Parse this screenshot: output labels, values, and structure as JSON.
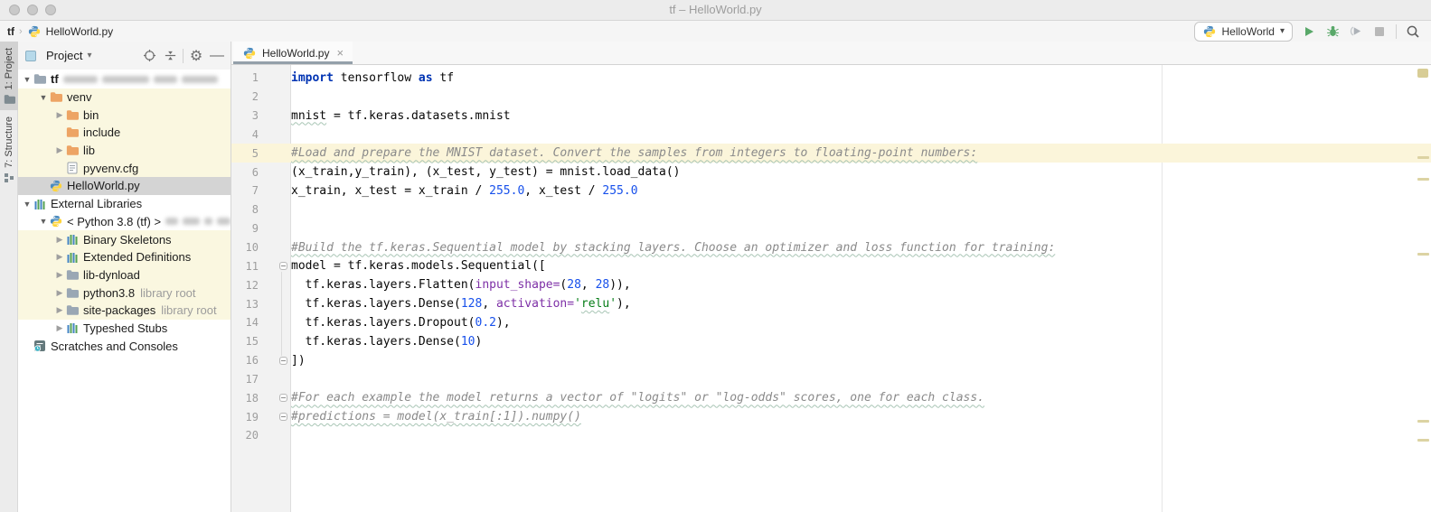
{
  "window": {
    "title": "tf – HelloWorld.py",
    "traffic_lights": [
      "close",
      "minimize",
      "zoom"
    ]
  },
  "breadcrumb": {
    "root": "tf",
    "separator": "›",
    "file": "HelloWorld.py",
    "file_icon": "python-icon"
  },
  "toolbar": {
    "run_config": {
      "label": "HelloWorld",
      "icon": "python-icon",
      "caret": "▾"
    },
    "actions": [
      {
        "name": "run-button",
        "icon": "play-icon",
        "color": "#59a869"
      },
      {
        "name": "debug-button",
        "icon": "bug-icon",
        "color": "#59a869"
      },
      {
        "name": "coverage-button",
        "icon": "run-with-coverage-icon",
        "color": "#9aa0a6"
      },
      {
        "name": "stop-button",
        "icon": "stop-icon",
        "color": "#b8b8b8"
      },
      {
        "name": "search-everywhere-button",
        "icon": "search-icon",
        "color": "#5f5f5f"
      }
    ]
  },
  "tool_strip": {
    "items": [
      {
        "label": "1: Project",
        "icon": "project-tool-icon",
        "active": true
      },
      {
        "label": "7: Structure",
        "icon": "structure-tool-icon",
        "active": false
      }
    ]
  },
  "project_panel": {
    "title": "Project",
    "caret": "▾",
    "header_icons": [
      "locate-icon",
      "collapse-all-icon",
      "settings-gear-icon",
      "hide-icon"
    ],
    "tree": [
      {
        "level": 0,
        "arrow": "exp",
        "icon": "folder",
        "label": "tf",
        "bold": true,
        "redacted": true,
        "bg": "none"
      },
      {
        "level": 1,
        "arrow": "exp",
        "icon": "folder-orange",
        "label": "venv",
        "bg": "yellow"
      },
      {
        "level": 2,
        "arrow": "col",
        "icon": "folder-orange",
        "label": "bin",
        "bg": "yellow"
      },
      {
        "level": 2,
        "arrow": "none",
        "icon": "folder-orange",
        "label": "include",
        "bg": "yellow"
      },
      {
        "level": 2,
        "arrow": "col",
        "icon": "folder-orange",
        "label": "lib",
        "bg": "yellow"
      },
      {
        "level": 2,
        "arrow": "none",
        "icon": "file",
        "label": "pyvenv.cfg",
        "bg": "yellow"
      },
      {
        "level": 1,
        "arrow": "none",
        "icon": "python",
        "label": "HelloWorld.py",
        "bg": "selected"
      },
      {
        "level": 0,
        "arrow": "exp",
        "icon": "library",
        "label": "External Libraries",
        "bg": "none"
      },
      {
        "level": 1,
        "arrow": "exp",
        "icon": "python",
        "label": "< Python 3.8 (tf) >",
        "redacted": true,
        "bg": "none"
      },
      {
        "level": 2,
        "arrow": "col",
        "icon": "library",
        "label": "Binary Skeletons",
        "bg": "yellow"
      },
      {
        "level": 2,
        "arrow": "col",
        "icon": "library",
        "label": "Extended Definitions",
        "bg": "yellow"
      },
      {
        "level": 2,
        "arrow": "col",
        "icon": "folder",
        "label": "lib-dynload",
        "bg": "yellow"
      },
      {
        "level": 2,
        "arrow": "col",
        "icon": "folder",
        "label": "python3.8",
        "suffix": "library root",
        "bg": "yellow"
      },
      {
        "level": 2,
        "arrow": "col",
        "icon": "folder",
        "label": "site-packages",
        "suffix": "library root",
        "bg": "yellow"
      },
      {
        "level": 2,
        "arrow": "col",
        "icon": "library",
        "label": "Typeshed Stubs",
        "bg": "none"
      },
      {
        "level": 0,
        "arrow": "none",
        "icon": "scratches",
        "label": "Scratches and Consoles",
        "bg": "none"
      }
    ]
  },
  "editor": {
    "tab": {
      "label": "HelloWorld.py",
      "icon": "python-icon",
      "close": "×"
    },
    "highlight_line": 5,
    "fold_lines": [
      11,
      16,
      18,
      19
    ],
    "fold_link": {
      "from_line": 11,
      "to_line": 16
    },
    "syntax_colors": {
      "keyword": "#0033b3",
      "number": "#1750eb",
      "string": "#067d17",
      "named_param": "#7d2fa6",
      "comment": "#8a8a8a",
      "plain": "#070707",
      "caret_row": "#fbf5da",
      "library_row": "#faf7e0"
    },
    "lines": [
      [
        {
          "s": "import ",
          "c": "kw"
        },
        {
          "s": "tensorflow ",
          "c": "pl"
        },
        {
          "s": "as ",
          "c": "kw"
        },
        {
          "s": "tf",
          "c": "pl"
        }
      ],
      [],
      [
        {
          "s": "mnist",
          "c": "pl typo"
        },
        {
          "s": " = tf.keras.datasets.mnist",
          "c": "pl"
        }
      ],
      [],
      [
        {
          "s": "#Load and prepare the MNIST dataset. Convert the samples from integers to floating-point numbers:",
          "c": "cm typo"
        }
      ],
      [
        {
          "s": "(x_train,y_train), (x_test, y_test) = mnist.load_data()",
          "c": "pl"
        }
      ],
      [
        {
          "s": "x_train, x_test = x_train / ",
          "c": "pl"
        },
        {
          "s": "255.0",
          "c": "num"
        },
        {
          "s": ", x_test / ",
          "c": "pl"
        },
        {
          "s": "255.0",
          "c": "num"
        }
      ],
      [],
      [],
      [
        {
          "s": "#Build the tf.keras.Sequential model by stacking layers. Choose an optimizer and loss function for training:",
          "c": "cm typo"
        }
      ],
      [
        {
          "s": "model = tf.keras.models.Sequential([",
          "c": "pl"
        }
      ],
      [
        {
          "s": "  tf.keras.layers.Flatten(",
          "c": "pl"
        },
        {
          "s": "input_shape=",
          "c": "par"
        },
        {
          "s": "(",
          "c": "pl"
        },
        {
          "s": "28",
          "c": "num"
        },
        {
          "s": ", ",
          "c": "pl"
        },
        {
          "s": "28",
          "c": "num"
        },
        {
          "s": ")),",
          "c": "pl"
        }
      ],
      [
        {
          "s": "  tf.keras.layers.Dense(",
          "c": "pl"
        },
        {
          "s": "128",
          "c": "num"
        },
        {
          "s": ", ",
          "c": "pl"
        },
        {
          "s": "activation=",
          "c": "par"
        },
        {
          "s": "'",
          "c": "str"
        },
        {
          "s": "relu",
          "c": "str typo"
        },
        {
          "s": "'",
          "c": "str"
        },
        {
          "s": "),",
          "c": "pl"
        }
      ],
      [
        {
          "s": "  tf.keras.layers.Dropout(",
          "c": "pl"
        },
        {
          "s": "0.2",
          "c": "num"
        },
        {
          "s": "),",
          "c": "pl"
        }
      ],
      [
        {
          "s": "  tf.keras.layers.Dense(",
          "c": "pl"
        },
        {
          "s": "10",
          "c": "num"
        },
        {
          "s": ")",
          "c": "pl"
        }
      ],
      [
        {
          "s": "])",
          "c": "pl"
        }
      ],
      [],
      [
        {
          "s": "#For each example the model returns a vector of \"logits\" or \"log-odds\" scores, one for each class.",
          "c": "cm typo"
        }
      ],
      [
        {
          "s": "#predictions = model(x_train[:1]).numpy()",
          "c": "cm typo"
        }
      ],
      []
    ]
  },
  "error_stripe": {
    "indicator_color": "#d8cd96",
    "mark_color": "#dcd3a3",
    "marks_y": [
      101,
      125,
      208,
      393,
      414
    ]
  }
}
